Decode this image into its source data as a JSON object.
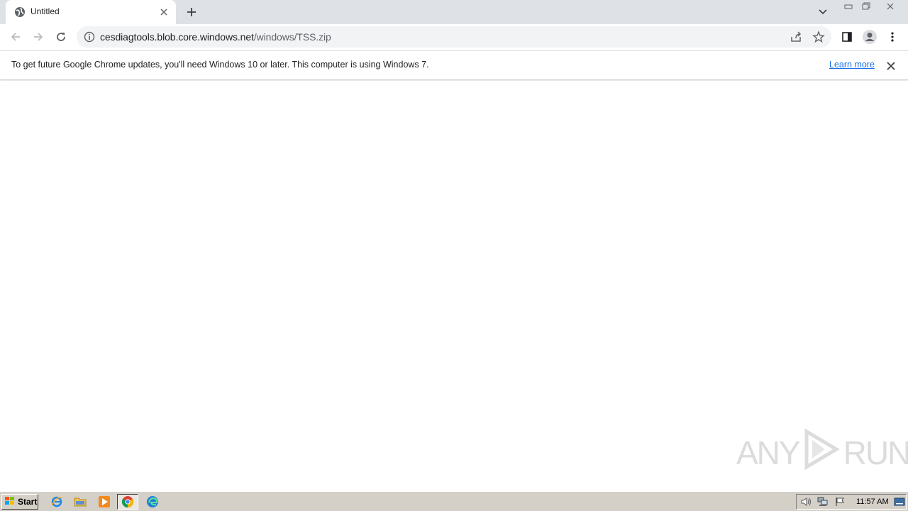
{
  "browser": {
    "tab": {
      "title": "Untitled"
    },
    "omnibox": {
      "url_host": "cesdiagtools.blob.core.windows.net",
      "url_path": "/windows/TSS.zip"
    },
    "infobar": {
      "message": "To get future Google Chrome updates, you'll need Windows 10 or later. This computer is using Windows 7.",
      "link": "Learn more"
    }
  },
  "watermark": {
    "left": "ANY",
    "right": "RUN"
  },
  "taskbar": {
    "start_label": "Start",
    "clock": "11:57 AM",
    "icons": [
      "internet-explorer-icon",
      "folder-icon",
      "media-player-icon",
      "chrome-icon",
      "edge-icon"
    ]
  },
  "colors": {
    "tabstrip": "#dee1e6",
    "omnibox": "#f1f3f4",
    "link": "#1a73e8",
    "taskbar": "#d4d0c8"
  }
}
